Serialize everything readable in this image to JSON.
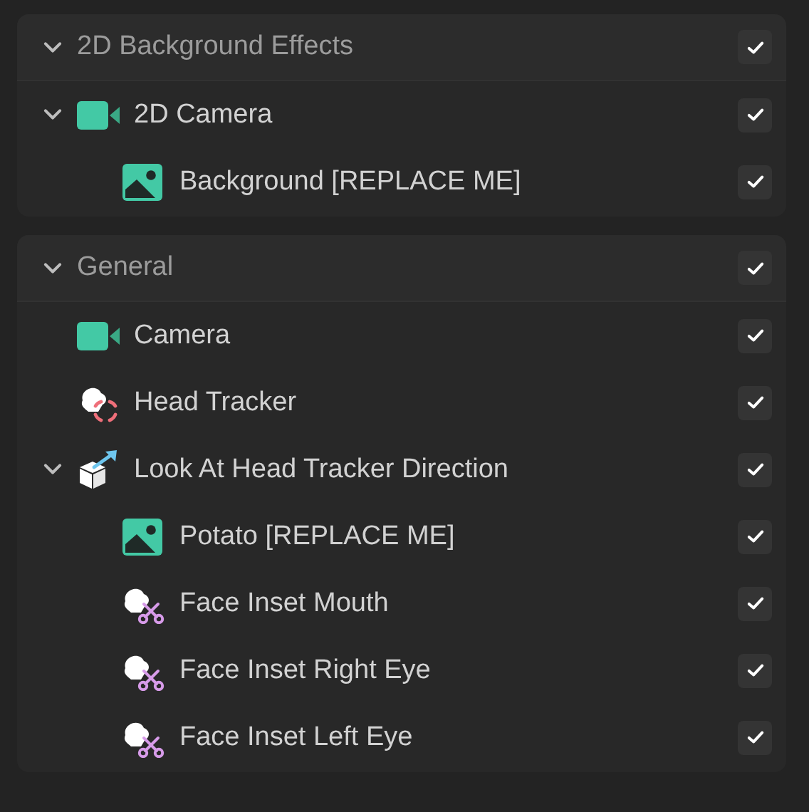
{
  "groups": [
    {
      "label": "2D Background Effects",
      "expanded": true,
      "checked": true,
      "items": [
        {
          "label": "2D Camera",
          "kind": "camera",
          "expanded": true,
          "checked": true,
          "children": [
            {
              "label": "Background [REPLACE ME]",
              "kind": "image",
              "checked": true
            }
          ]
        }
      ]
    },
    {
      "label": "General",
      "expanded": true,
      "checked": true,
      "items": [
        {
          "label": "Camera",
          "kind": "camera",
          "checked": true
        },
        {
          "label": "Head Tracker",
          "kind": "head-tracker",
          "checked": true
        },
        {
          "label": "Look At Head Tracker Direction",
          "kind": "look-at",
          "expanded": true,
          "checked": true,
          "children": [
            {
              "label": "Potato [REPLACE ME]",
              "kind": "image",
              "checked": true
            },
            {
              "label": "Face Inset Mouth",
              "kind": "face-inset",
              "checked": true
            },
            {
              "label": "Face Inset Right Eye",
              "kind": "face-inset",
              "checked": true
            },
            {
              "label": "Face Inset Left Eye",
              "kind": "face-inset",
              "checked": true
            }
          ]
        }
      ]
    }
  ]
}
